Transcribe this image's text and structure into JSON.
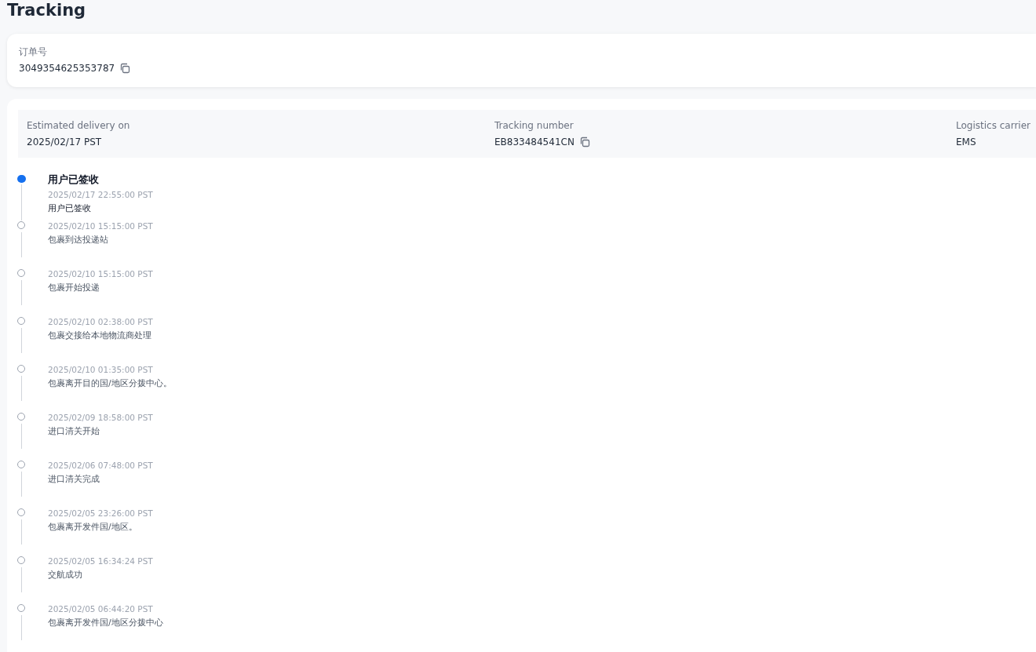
{
  "page_title": "Tracking",
  "order": {
    "label": "订单号",
    "value": "3049354625353787"
  },
  "summary": [
    {
      "kind": "text",
      "label": "Estimated delivery on",
      "value": "2025/02/17 PST"
    },
    {
      "kind": "copy",
      "label": "Tracking number",
      "value": "EB833484541CN"
    },
    {
      "kind": "text",
      "label": "Logistics carrier",
      "value": "EMS"
    }
  ],
  "events": [
    {
      "current": true,
      "title": "用户已签收",
      "time": "2025/02/17 22:55:00 PST",
      "description": "用户已签收"
    },
    {
      "current": false,
      "time": "2025/02/10 15:15:00 PST",
      "description": "包裹到达投递站"
    },
    {
      "current": false,
      "time": "2025/02/10 15:15:00 PST",
      "description": "包裹开始投递"
    },
    {
      "current": false,
      "time": "2025/02/10 02:38:00 PST",
      "description": "包裹交接给本地物流商处理"
    },
    {
      "current": false,
      "time": "2025/02/10 01:35:00 PST",
      "description": "包裹离开目的国/地区分拨中心。"
    },
    {
      "current": false,
      "time": "2025/02/09 18:58:00 PST",
      "description": "进口清关开始"
    },
    {
      "current": false,
      "time": "2025/02/06 07:48:00 PST",
      "description": "进口清关完成"
    },
    {
      "current": false,
      "time": "2025/02/05 23:26:00 PST",
      "description": "包裹离开发件国/地区。"
    },
    {
      "current": false,
      "time": "2025/02/05 16:34:24 PST",
      "description": "交航成功"
    },
    {
      "current": false,
      "time": "2025/02/05 06:44:20 PST",
      "description": "包裹离开发件国/地区分拨中心"
    }
  ]
}
